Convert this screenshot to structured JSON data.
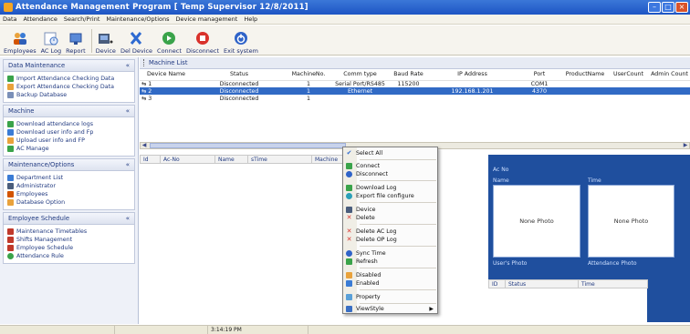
{
  "window": {
    "title": "Attendance Management Program   [ Temp Supervisor 12/8/2011]"
  },
  "menu": [
    "Data",
    "Attendance",
    "Search/Print",
    "Maintenance/Options",
    "Device management",
    "Help"
  ],
  "toolbar": {
    "employees": "Employees",
    "aclog": "AC Log",
    "report": "Report",
    "device": "Device",
    "deldevice": "Del Device",
    "connect": "Connect",
    "disconnect": "Disconnect",
    "exit": "Exit system"
  },
  "sidebar": {
    "data_maintenance": {
      "title": "Data Maintenance",
      "items": [
        "Import Attendance Checking Data",
        "Export Attendance Checking Data",
        "Backup Database"
      ]
    },
    "machine": {
      "title": "Machine",
      "items": [
        "Download attendance logs",
        "Download user info and Fp",
        "Upload user info and FP",
        "AC Manage"
      ]
    },
    "maintenance": {
      "title": "Maintenance/Options",
      "items": [
        "Department List",
        "Administrator",
        "Employees",
        "Database Option"
      ]
    },
    "schedule": {
      "title": "Employee Schedule",
      "items": [
        "Maintenance Timetables",
        "Shifts Management",
        "Employee Schedule",
        "Attendance Rule"
      ]
    }
  },
  "main": {
    "title": "Machine List",
    "columns": [
      "Device Name",
      "Status",
      "MachineNo.",
      "Comm type",
      "Baud Rate",
      "IP Address",
      "Port",
      "ProductName",
      "UserCount",
      "Admin Count"
    ],
    "rows": [
      [
        "1",
        "Disconnected",
        "1",
        "Serial Port/RS485",
        "115200",
        "",
        "COM1",
        "",
        "",
        ""
      ],
      [
        "2",
        "Disconnected",
        "1",
        "Ethernet",
        "",
        "192.168.1.201",
        "4370",
        "",
        "",
        ""
      ],
      [
        "3",
        "Disconnected",
        "1",
        "",
        "",
        "",
        "",
        "",
        "",
        ""
      ]
    ],
    "log_columns": [
      "Id",
      "Ac-No",
      "Name",
      "sTime",
      "Machine"
    ]
  },
  "right_panel": {
    "ac_no": "Ac No",
    "name": "Name",
    "time": "Time",
    "none_photo_1": "None Photo",
    "none_photo_2": "None Photo",
    "users_photo": "User's Photo",
    "attendance_photo": "Attendance Photo",
    "grid_columns": [
      "ID",
      "Status",
      "Time"
    ]
  },
  "context_menu": {
    "items": [
      "Select All",
      "Connect",
      "Disconnect",
      "Download Log",
      "Export file configure",
      "Device",
      "Delete",
      "Delete AC Log",
      "Delete OP Log",
      "Sync Time",
      "Refresh",
      "Disabled",
      "Enabled",
      "Property",
      "ViewStyle"
    ]
  },
  "statusbar": {
    "time": "3:14:19 PM"
  },
  "colors": {
    "selection": "#316ac5",
    "title_blue": "#1d55c4",
    "panel_blue": "#1f4f9e"
  }
}
